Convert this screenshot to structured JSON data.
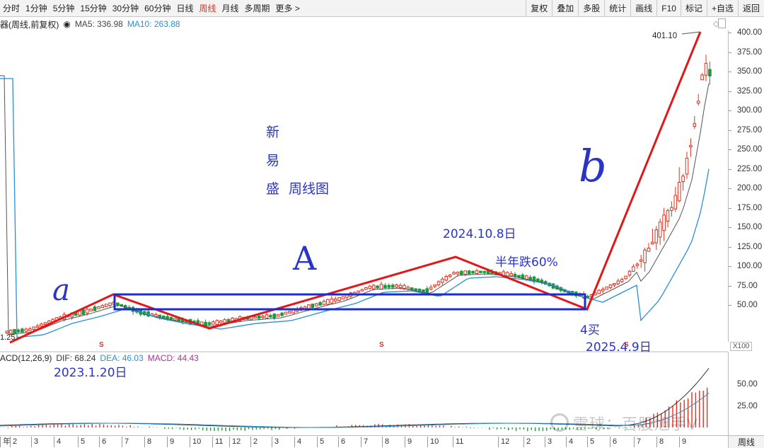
{
  "toolbar": {
    "periods": [
      {
        "label": "分时",
        "active": false
      },
      {
        "label": "1分钟",
        "active": false
      },
      {
        "label": "5分钟",
        "active": false
      },
      {
        "label": "15分钟",
        "active": false
      },
      {
        "label": "30分钟",
        "active": false
      },
      {
        "label": "60分钟",
        "active": false
      },
      {
        "label": "日线",
        "active": false
      },
      {
        "label": "周线",
        "active": true
      },
      {
        "label": "月线",
        "active": false
      },
      {
        "label": "多周期",
        "active": false
      },
      {
        "label": "更多 >",
        "active": false
      }
    ],
    "tools": [
      "复权",
      "叠加",
      "多股",
      "统计",
      "画线",
      "F10",
      "标记",
      "+自选",
      "返回"
    ]
  },
  "info": {
    "title": "器(周线,前复权)",
    "ma5_label": "MA5: 336.98",
    "ma10_label": "MA10: 263.88",
    "colors": {
      "ma5": "#444444",
      "ma10": "#2a8fd6",
      "up": "#e0301e",
      "down": "#1a9a3a"
    }
  },
  "price_axis": [
    "400.00",
    "375.00",
    "350.00",
    "325.00",
    "300.00",
    "275.00",
    "250.00",
    "225.00",
    "200.00",
    "175.00",
    "150.00",
    "125.00",
    "100.00",
    "75.00",
    "50.00"
  ],
  "max_label": "401.10",
  "min_label": "1.25",
  "scale_button": "X100",
  "macd": {
    "label": "ACD(12,26,9)",
    "dif": "DIF: 68.24",
    "dea": "DEA: 46.03",
    "macd": "MACD: 44.43",
    "axis": [
      "50.00",
      "25.00"
    ]
  },
  "date_axis": [
    "年",
    "2",
    "3",
    "4",
    "5",
    "6",
    "7",
    "8",
    "9",
    "10",
    "11",
    "12",
    "2",
    "3",
    "4",
    "5",
    "6",
    "7",
    "8",
    "9",
    "10",
    "11",
    "12",
    "2",
    "3",
    "4",
    "5",
    "6",
    "7",
    "8",
    "9"
  ],
  "period_label": "周线",
  "annotations": {
    "stock_name_1": "新",
    "stock_name_2": "易",
    "stock_name_3": "盛",
    "chart_kind": "周线图",
    "letter_a": "a",
    "letter_A": "A",
    "letter_b": "b",
    "date_peak": "2024.10.8日",
    "drop_note": "半年跌60%",
    "date_start": "2023.1.20日",
    "buy_note": "4买",
    "date_buy": "2025.4.9日"
  },
  "event_markers": [
    "S",
    "S",
    "S"
  ],
  "watermark": "雪球：百股旭手V"
}
